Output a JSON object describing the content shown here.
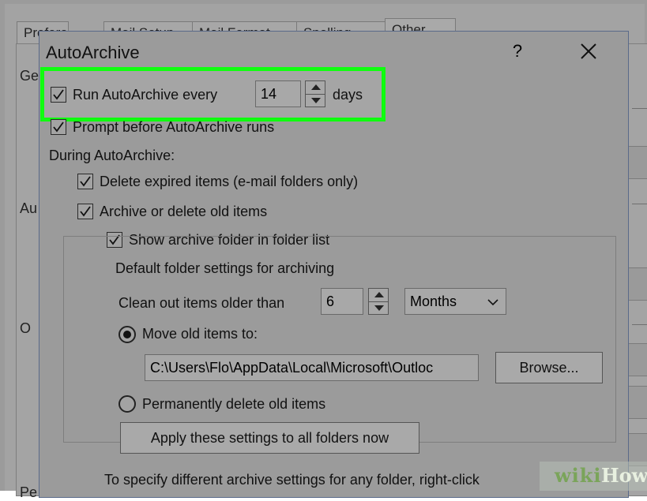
{
  "parent_dialog": {
    "tabs": [
      "Preferences",
      "Mail Setup",
      "Mail Format",
      "Spelling",
      "Other"
    ],
    "side_labels": [
      "Ge",
      "Au",
      "O",
      "Pe"
    ]
  },
  "dialog": {
    "title": "AutoArchive",
    "help": "?",
    "close": "✕"
  },
  "run_autoarchive": {
    "label": "Run AutoArchive every",
    "checked": true,
    "value": "14",
    "unit": "days"
  },
  "prompt_before": {
    "label": "Prompt before AutoArchive runs",
    "checked": true
  },
  "during_label": "During AutoArchive:",
  "delete_expired": {
    "label": "Delete expired items (e-mail folders only)",
    "checked": true
  },
  "archive_old": {
    "label": "Archive or delete old items",
    "checked": true
  },
  "show_folder": {
    "label": "Show archive folder in folder list",
    "checked": true
  },
  "defaults_group": {
    "title": "Default folder settings for archiving",
    "clean_label": "Clean out items older than",
    "clean_value": "6",
    "period": "Months",
    "move_label": "Move old items to:",
    "move_selected": true,
    "path": "C:\\Users\\Flo\\AppData\\Local\\Microsoft\\Outloc",
    "browse": "Browse...",
    "delete_label": "Permanently delete old items",
    "apply": "Apply these settings to all folders now"
  },
  "footer_text": "To specify different archive settings for any folder, right-click",
  "watermark": {
    "wiki": "wiki",
    "how": "How"
  },
  "colors": {
    "highlight": "#0fff0f",
    "background": "#9b9b9b"
  }
}
